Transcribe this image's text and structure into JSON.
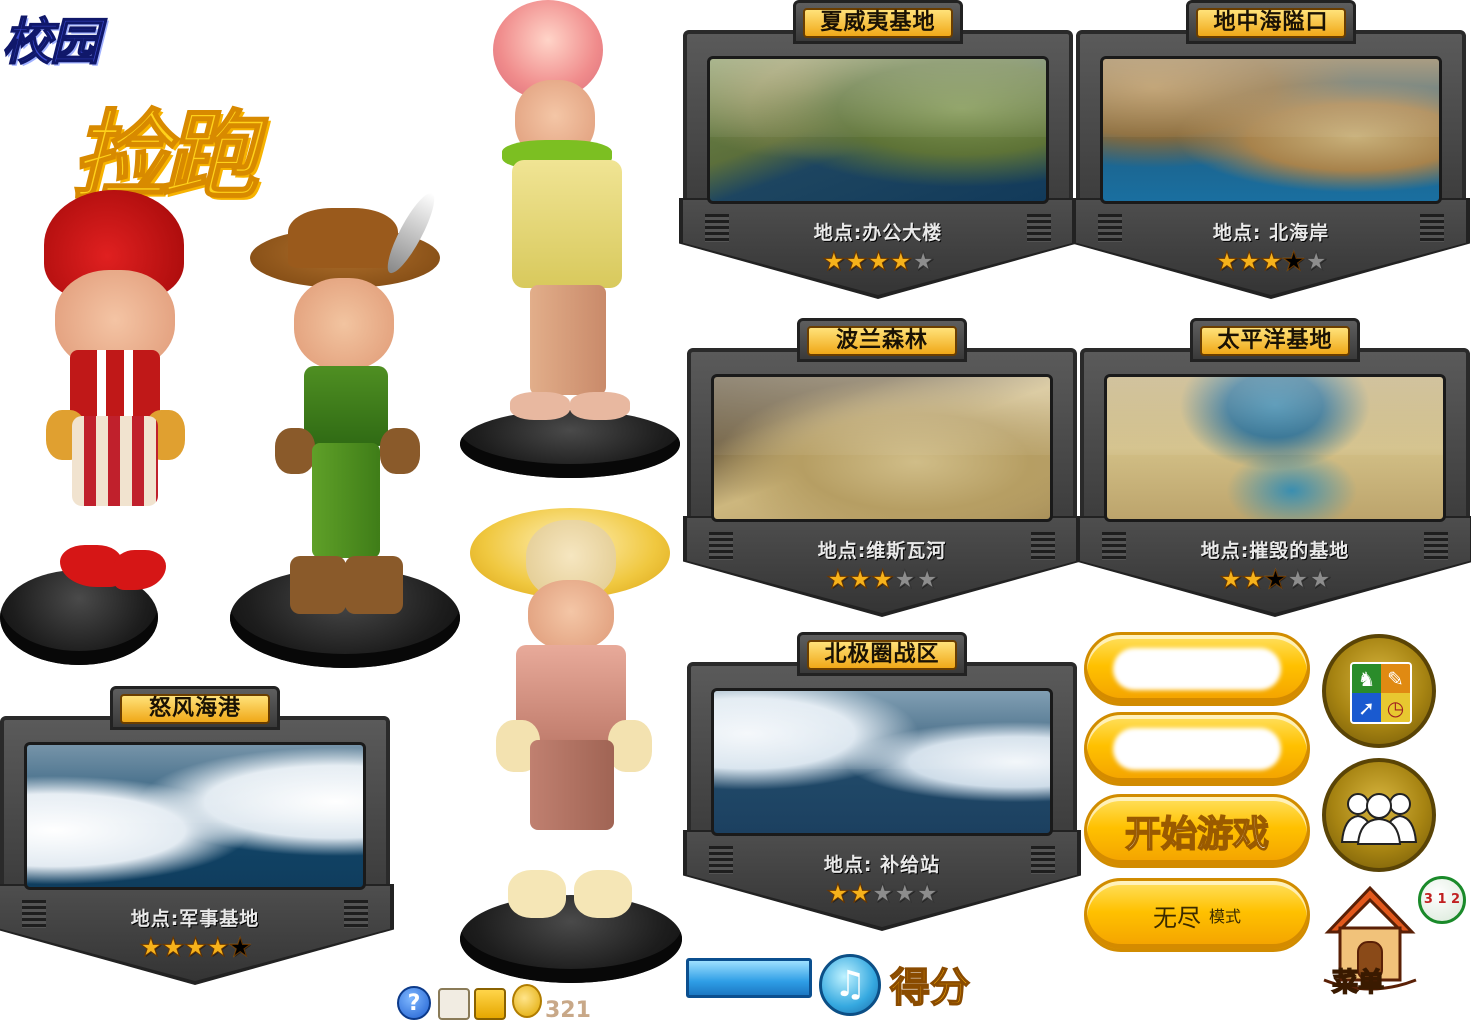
{
  "title": {
    "line1": "校园",
    "line2": "捡跑"
  },
  "maps": [
    {
      "id": "hawaii",
      "name": "夏威夷基地",
      "location": "地点:办公大楼",
      "stars": [
        1,
        1,
        1,
        1,
        0
      ],
      "terrain": "t-green"
    },
    {
      "id": "mediterranean",
      "name": "地中海隘口",
      "location": "地点: 北海岸",
      "stars": [
        1,
        1,
        1,
        0.5,
        0
      ],
      "terrain": "t-coast"
    },
    {
      "id": "poland",
      "name": "波兰森林",
      "location": "地点:维斯瓦河",
      "stars": [
        1,
        1,
        1,
        0,
        0
      ],
      "terrain": "t-desert"
    },
    {
      "id": "pacific",
      "name": "太平洋基地",
      "location": "地点:摧毁的基地",
      "stars": [
        1,
        1,
        0.5,
        0,
        0
      ],
      "terrain": "t-oasis"
    },
    {
      "id": "arctic",
      "name": "北极圈战区",
      "location": "地点: 补给站",
      "stars": [
        1,
        1,
        0,
        0,
        0
      ],
      "terrain": "t-ice"
    },
    {
      "id": "storm",
      "name": "怒风海港",
      "location": "地点:军事基地",
      "stars": [
        1,
        1,
        1,
        1,
        0.5
      ],
      "terrain": "t-snow"
    }
  ],
  "buttons": {
    "start_game": "开始游戏",
    "endless_a": "无尽",
    "endless_b": "模式",
    "menu": "菜单",
    "score": "得分"
  },
  "hud": {
    "help": "?",
    "coins": "321",
    "rank_badge": "3 1 2"
  },
  "icons": {
    "tools": "tool-quad-icon",
    "friends": "friends-icon",
    "music": "music-note-icon",
    "home": "home-icon"
  }
}
